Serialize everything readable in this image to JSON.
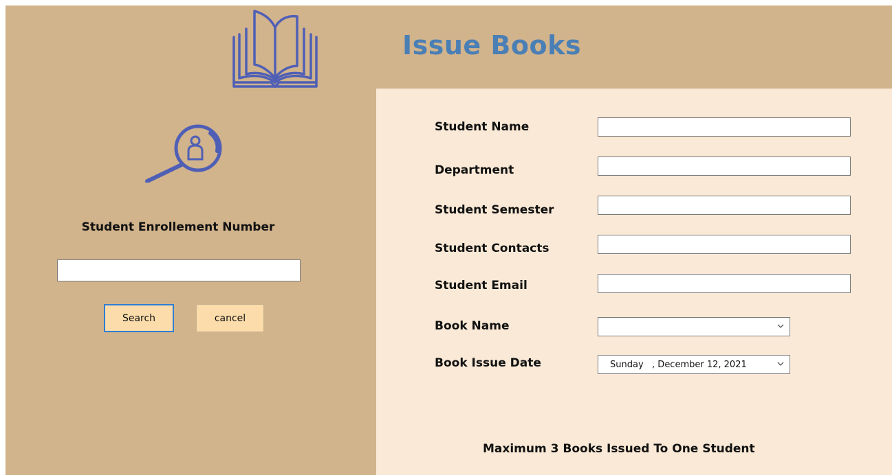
{
  "header": {
    "title": "Issue Books",
    "book_icon": "open-book-icon",
    "title_color": "#4a7fb5"
  },
  "left_panel": {
    "search_icon": "user-search-icon",
    "enrollment_label": "Student Enrollement Number",
    "enrollment_value": "",
    "search_label": "Search",
    "cancel_label": "cancel"
  },
  "form": {
    "student_name_label": "Student Name",
    "student_name_value": "",
    "department_label": "Department",
    "department_value": "",
    "semester_label": "Student Semester",
    "semester_value": "",
    "contacts_label": "Student Contacts",
    "contacts_value": "",
    "email_label": "Student Email",
    "email_value": "",
    "book_name_label": "Book Name",
    "book_name_value": "",
    "issue_date_label": "Book Issue Date",
    "issue_date_value": "Sunday   , December 12, 2021"
  },
  "footer": {
    "note": "Maximum 3 Books Issued To One Student"
  },
  "colors": {
    "panel_bg": "#d1b38c",
    "form_bg": "#f9e9d6",
    "button_bg": "#fbdcaa",
    "focus_border": "#2d7ed2",
    "icon_color": "#4f5fb5"
  }
}
